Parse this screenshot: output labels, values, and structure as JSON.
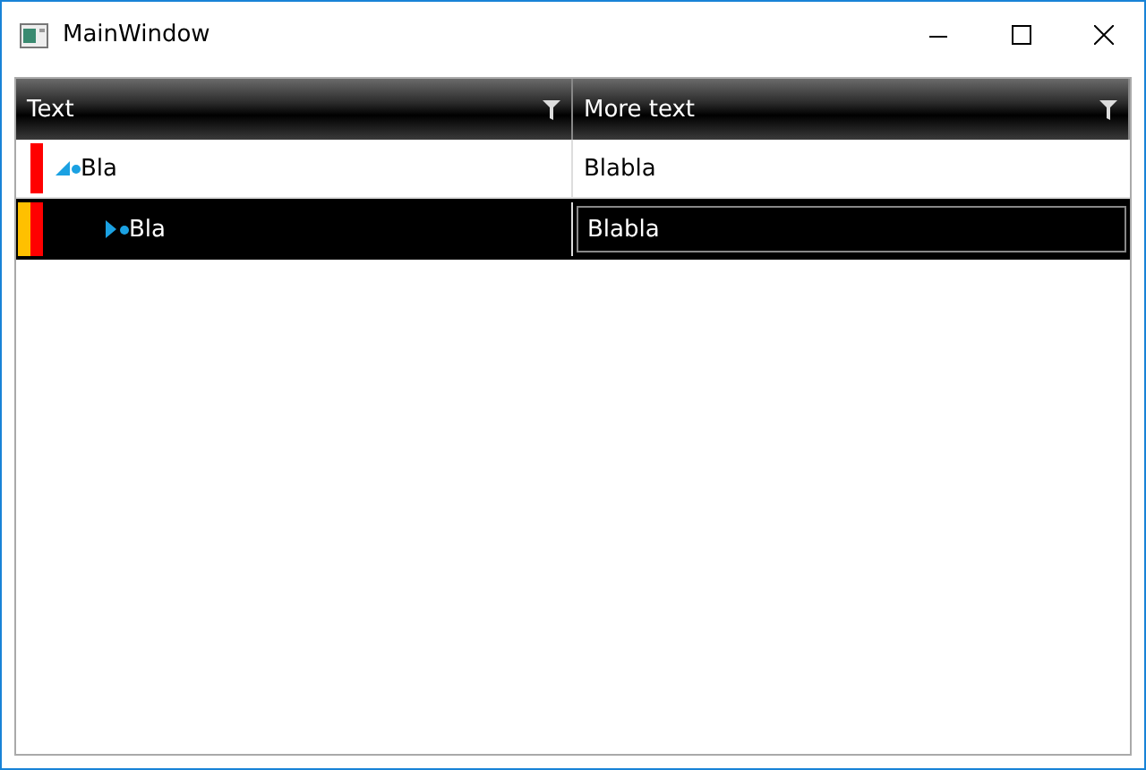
{
  "window": {
    "title": "MainWindow"
  },
  "columns": [
    {
      "label": "Text"
    },
    {
      "label": "More text"
    }
  ],
  "rows": [
    {
      "text": "Bla",
      "more": "Blabla",
      "expanded": true,
      "selected": false,
      "markers": [
        {
          "color": "#ff0000"
        }
      ],
      "children": [
        {
          "text": "Bla",
          "more": "Blabla",
          "expanded": false,
          "selected": true,
          "markers": [
            {
              "color": "#ffc000"
            },
            {
              "color": "#ff0000"
            }
          ]
        }
      ]
    }
  ]
}
